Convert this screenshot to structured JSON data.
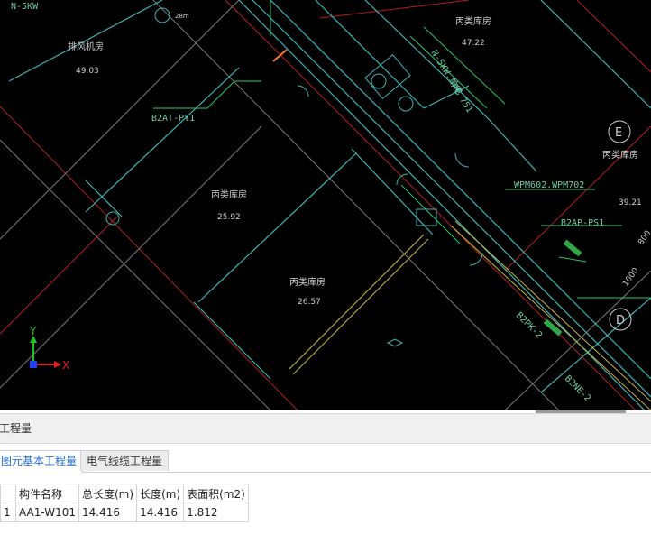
{
  "cad": {
    "room_labels": [
      {
        "name": "排风机房",
        "area": "49.03"
      },
      {
        "name": "丙类库房",
        "area": "47.22"
      },
      {
        "name": "丙类库房",
        "area": "25.92"
      },
      {
        "name": "丙类库房",
        "area": "26.57"
      },
      {
        "name": "丙类库房",
        "area": "39.21"
      }
    ],
    "annotations": [
      "N-5KW",
      "B2AT-PY1",
      "WPM602.WPM702",
      "B2AP-PS1",
      "N-5KW,单电",
      "AC 751",
      "B2PK-2",
      "B2NE-2",
      "1000",
      "800",
      "28m"
    ],
    "grid_markers": [
      "E",
      "D"
    ],
    "axis": {
      "y_label": "Y",
      "x_label": "X",
      "y_color": "#22c422",
      "x_color": "#e02020"
    }
  },
  "panel": {
    "title": "工程量",
    "tabs": [
      {
        "label": "图元基本工程量",
        "active": true
      },
      {
        "label": "电气线缆工程量",
        "active": false
      }
    ],
    "table": {
      "headers": [
        "",
        "构件名称",
        "总长度(m)",
        "长度(m)",
        "表面积(m2)"
      ],
      "rows": [
        [
          "1",
          "AA1-W101",
          "14.416",
          "14.416",
          "1.812"
        ]
      ]
    }
  }
}
